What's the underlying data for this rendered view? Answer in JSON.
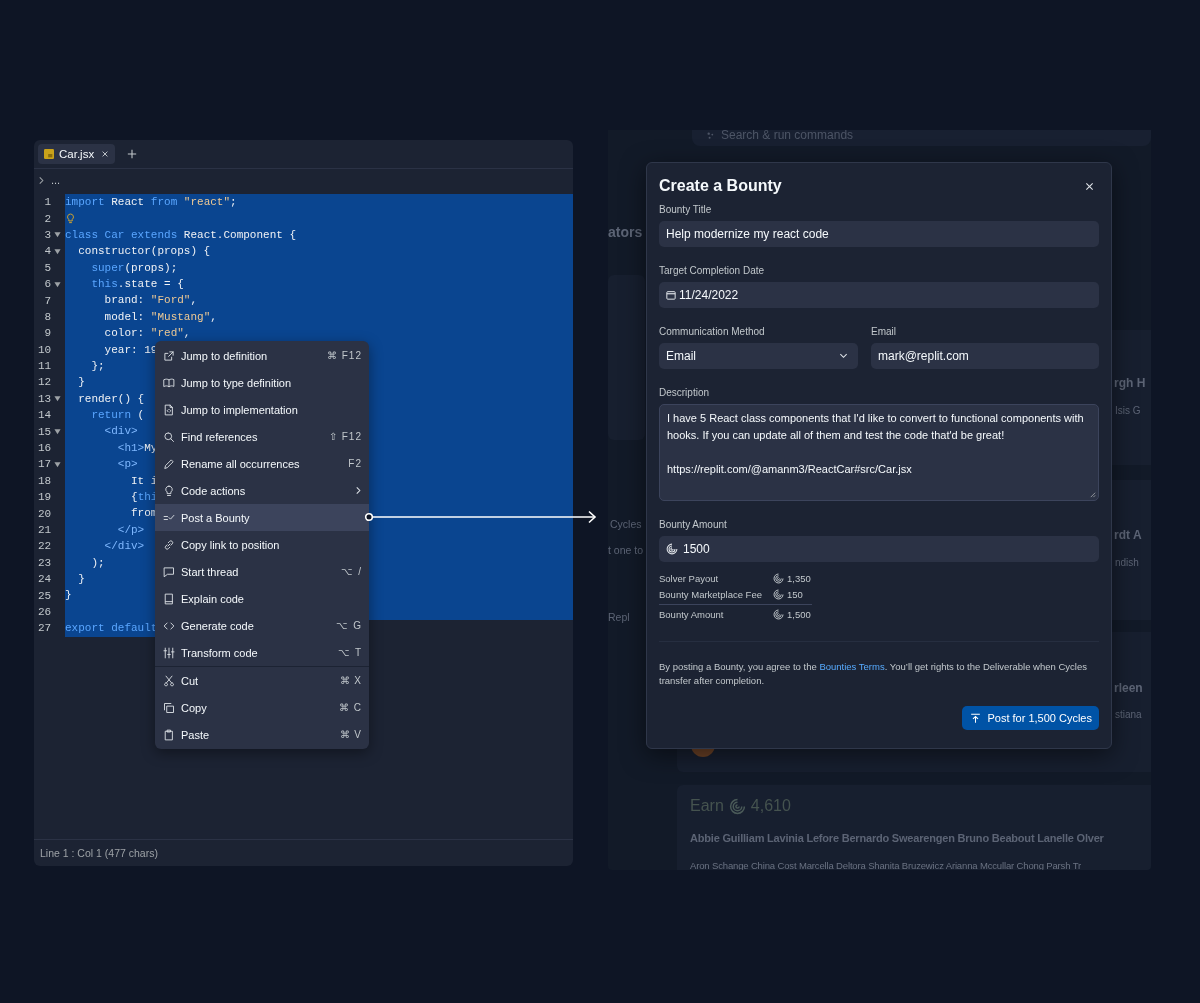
{
  "editor": {
    "tabs": [
      {
        "label": "Car.jsx",
        "selected": true
      }
    ],
    "breadcrumb": "...",
    "lines": [
      {
        "number": "1",
        "selected": true,
        "tokens": [
          {
            "text": "import",
            "kind": "keyword"
          },
          {
            "text": " React ",
            "kind": "plain"
          },
          {
            "text": "from",
            "kind": "keyword"
          },
          {
            "text": " \"react\"",
            "kind": "string"
          },
          {
            "text": ";",
            "kind": "plain"
          }
        ]
      },
      {
        "number": "2",
        "selected": true,
        "hint": true
      },
      {
        "number": "3",
        "selected": true,
        "foldable": true,
        "tokens": [
          {
            "text": "class",
            "kind": "keyword"
          },
          {
            "text": " Car",
            "kind": "keyword"
          },
          {
            "text": " extends",
            "kind": "keyword"
          },
          {
            "text": " React.Component {",
            "kind": "plain"
          }
        ]
      },
      {
        "number": "4",
        "selected": true,
        "foldable": true,
        "tokens": [
          {
            "text": "  constructor(props) {",
            "kind": "plain"
          }
        ]
      },
      {
        "number": "5",
        "selected": true,
        "tokens": [
          {
            "text": "    super",
            "kind": "keyword"
          },
          {
            "text": "(props);",
            "kind": "plain"
          }
        ]
      },
      {
        "number": "6",
        "selected": true,
        "foldable": true,
        "tokens": [
          {
            "text": "    this",
            "kind": "keyword"
          },
          {
            "text": ".state = {",
            "kind": "plain"
          }
        ]
      },
      {
        "number": "7",
        "selected": true,
        "tokens": [
          {
            "text": "      brand: ",
            "kind": "plain"
          },
          {
            "text": "\"Ford\"",
            "kind": "string"
          },
          {
            "text": ",",
            "kind": "plain"
          }
        ]
      },
      {
        "number": "8",
        "selected": true,
        "tokens": [
          {
            "text": "      model: ",
            "kind": "plain"
          },
          {
            "text": "\"Mustang\"",
            "kind": "string"
          },
          {
            "text": ",",
            "kind": "plain"
          }
        ]
      },
      {
        "number": "9",
        "selected": true,
        "tokens": [
          {
            "text": "      color: ",
            "kind": "plain"
          },
          {
            "text": "\"red\"",
            "kind": "string"
          },
          {
            "text": ",",
            "kind": "plain"
          }
        ]
      },
      {
        "number": "10",
        "selected": true,
        "tokens": [
          {
            "text": "      year: 19",
            "kind": "plain"
          }
        ]
      },
      {
        "number": "11",
        "selected": true,
        "tokens": [
          {
            "text": "    };",
            "kind": "plain"
          }
        ]
      },
      {
        "number": "12",
        "selected": true,
        "tokens": [
          {
            "text": "  }",
            "kind": "plain"
          }
        ]
      },
      {
        "number": "13",
        "selected": true,
        "foldable": true,
        "tokens": [
          {
            "text": "  render() {",
            "kind": "plain"
          }
        ]
      },
      {
        "number": "14",
        "selected": true,
        "tokens": [
          {
            "text": "    return",
            "kind": "keyword"
          },
          {
            "text": " (",
            "kind": "plain"
          }
        ]
      },
      {
        "number": "15",
        "selected": true,
        "foldable": true,
        "tokens": [
          {
            "text": "      <div>",
            "kind": "tag"
          }
        ]
      },
      {
        "number": "16",
        "selected": true,
        "tokens": [
          {
            "text": "        <h1>",
            "kind": "tag"
          },
          {
            "text": "My",
            "kind": "plain"
          }
        ]
      },
      {
        "number": "17",
        "selected": true,
        "foldable": true,
        "tokens": [
          {
            "text": "        <p>",
            "kind": "tag"
          }
        ]
      },
      {
        "number": "18",
        "selected": true,
        "tokens": [
          {
            "text": "          It i",
            "kind": "plain"
          }
        ]
      },
      {
        "number": "19",
        "selected": true,
        "tokens": [
          {
            "text": "          {",
            "kind": "plain"
          },
          {
            "text": "thi",
            "kind": "keyword"
          }
        ]
      },
      {
        "number": "20",
        "selected": true,
        "tokens": [
          {
            "text": "          from",
            "kind": "plain"
          }
        ]
      },
      {
        "number": "21",
        "selected": true,
        "tokens": [
          {
            "text": "        </p>",
            "kind": "tag"
          }
        ]
      },
      {
        "number": "22",
        "selected": true,
        "tokens": [
          {
            "text": "      </div>",
            "kind": "tag"
          }
        ]
      },
      {
        "number": "23",
        "selected": true,
        "tokens": [
          {
            "text": "    );",
            "kind": "plain"
          }
        ]
      },
      {
        "number": "24",
        "selected": true,
        "tokens": [
          {
            "text": "  }",
            "kind": "plain"
          }
        ]
      },
      {
        "number": "25",
        "selected": true,
        "tokens": [
          {
            "text": "}",
            "kind": "plain"
          }
        ]
      },
      {
        "number": "26",
        "selected": true
      },
      {
        "number": "27",
        "selected": true,
        "partial": true,
        "tokens": [
          {
            "text": "export default",
            "kind": "keyword"
          }
        ]
      }
    ],
    "status": "Line 1 : Col 1 (477 chars)"
  },
  "context_menu": {
    "items": [
      {
        "label": "Jump to definition",
        "shortcut": "⌘ F12",
        "selected": false
      },
      {
        "label": "Jump to type definition",
        "selected": false
      },
      {
        "label": "Jump to implementation",
        "selected": false
      },
      {
        "label": "Find references",
        "shortcut": "⇧ F12",
        "selected": false
      },
      {
        "label": "Rename all occurrences",
        "shortcut": "F2",
        "selected": false
      },
      {
        "label": "Code actions",
        "submenu": true,
        "selected": false
      },
      {
        "label": "Post a Bounty",
        "selected": true
      },
      {
        "label": "Copy link to position",
        "selected": false
      },
      {
        "label": "Start thread",
        "shortcut": "⌥ /",
        "selected": false
      },
      {
        "label": "Explain code",
        "selected": false
      },
      {
        "label": "Generate code",
        "shortcut": "⌥ G",
        "selected": false
      },
      {
        "label": "Transform code",
        "shortcut": "⌥ T",
        "selected": false
      },
      {
        "label": "Cut",
        "shortcut": "⌘ X",
        "separator_before": true,
        "selected": false
      },
      {
        "label": "Copy",
        "shortcut": "⌘ C",
        "selected": false
      },
      {
        "label": "Paste",
        "shortcut": "⌘ V",
        "selected": false
      }
    ]
  },
  "background": {
    "search": {
      "placeholder": "Search & run commands"
    },
    "fragments": [
      "ators",
      "rgh H",
      "Isis G",
      "Cycles",
      "t one to",
      "Repl",
      "rdt A",
      "ndish",
      "rleen",
      "stiana"
    ],
    "earn": {
      "label": "Earn",
      "amount": "4,610"
    },
    "names": "Abbie Guilliam Lavinia Lefore Bernardo Swearengen Bruno Beabout Lanelle Olver",
    "names_2": "Aron Schange China Cost Marcella Deltora Shanita Bruzewicz Arianna Mccullar Chong Parsh Tr"
  },
  "modal": {
    "title": "Create a Bounty",
    "bounty_title": {
      "label": "Bounty Title",
      "value": "Help modernize my react code"
    },
    "date": {
      "label": "Target Completion Date",
      "value": "11/24/2022"
    },
    "method": {
      "label": "Communication Method",
      "value": "Email"
    },
    "email": {
      "label": "Email",
      "value": "mark@replit.com"
    },
    "description": {
      "label": "Description",
      "value": "I have 5 React class components that I'd like to convert to functional components with hooks. If you can update all of them and test the code that'd be great!\n\nhttps://replit.com/@amanm3/ReactCar#src/Car.jsx"
    },
    "amount": {
      "label": "Bounty Amount",
      "value": "1500"
    },
    "breakdown": [
      {
        "label": "Solver Payout",
        "amount": "1,350",
        "total": false
      },
      {
        "label": "Bounty Marketplace Fee",
        "amount": "150",
        "total": false
      },
      {
        "label": "Bounty Amount",
        "amount": "1,500",
        "total": true
      }
    ],
    "terms": {
      "before": "By posting a Bounty, you agree to the ",
      "link": "Bounties Terms",
      "after": ". You’ll get rights to the Deliverable when Cycles transfer after completion."
    },
    "submit": "Post for 1,500 Cycles"
  }
}
